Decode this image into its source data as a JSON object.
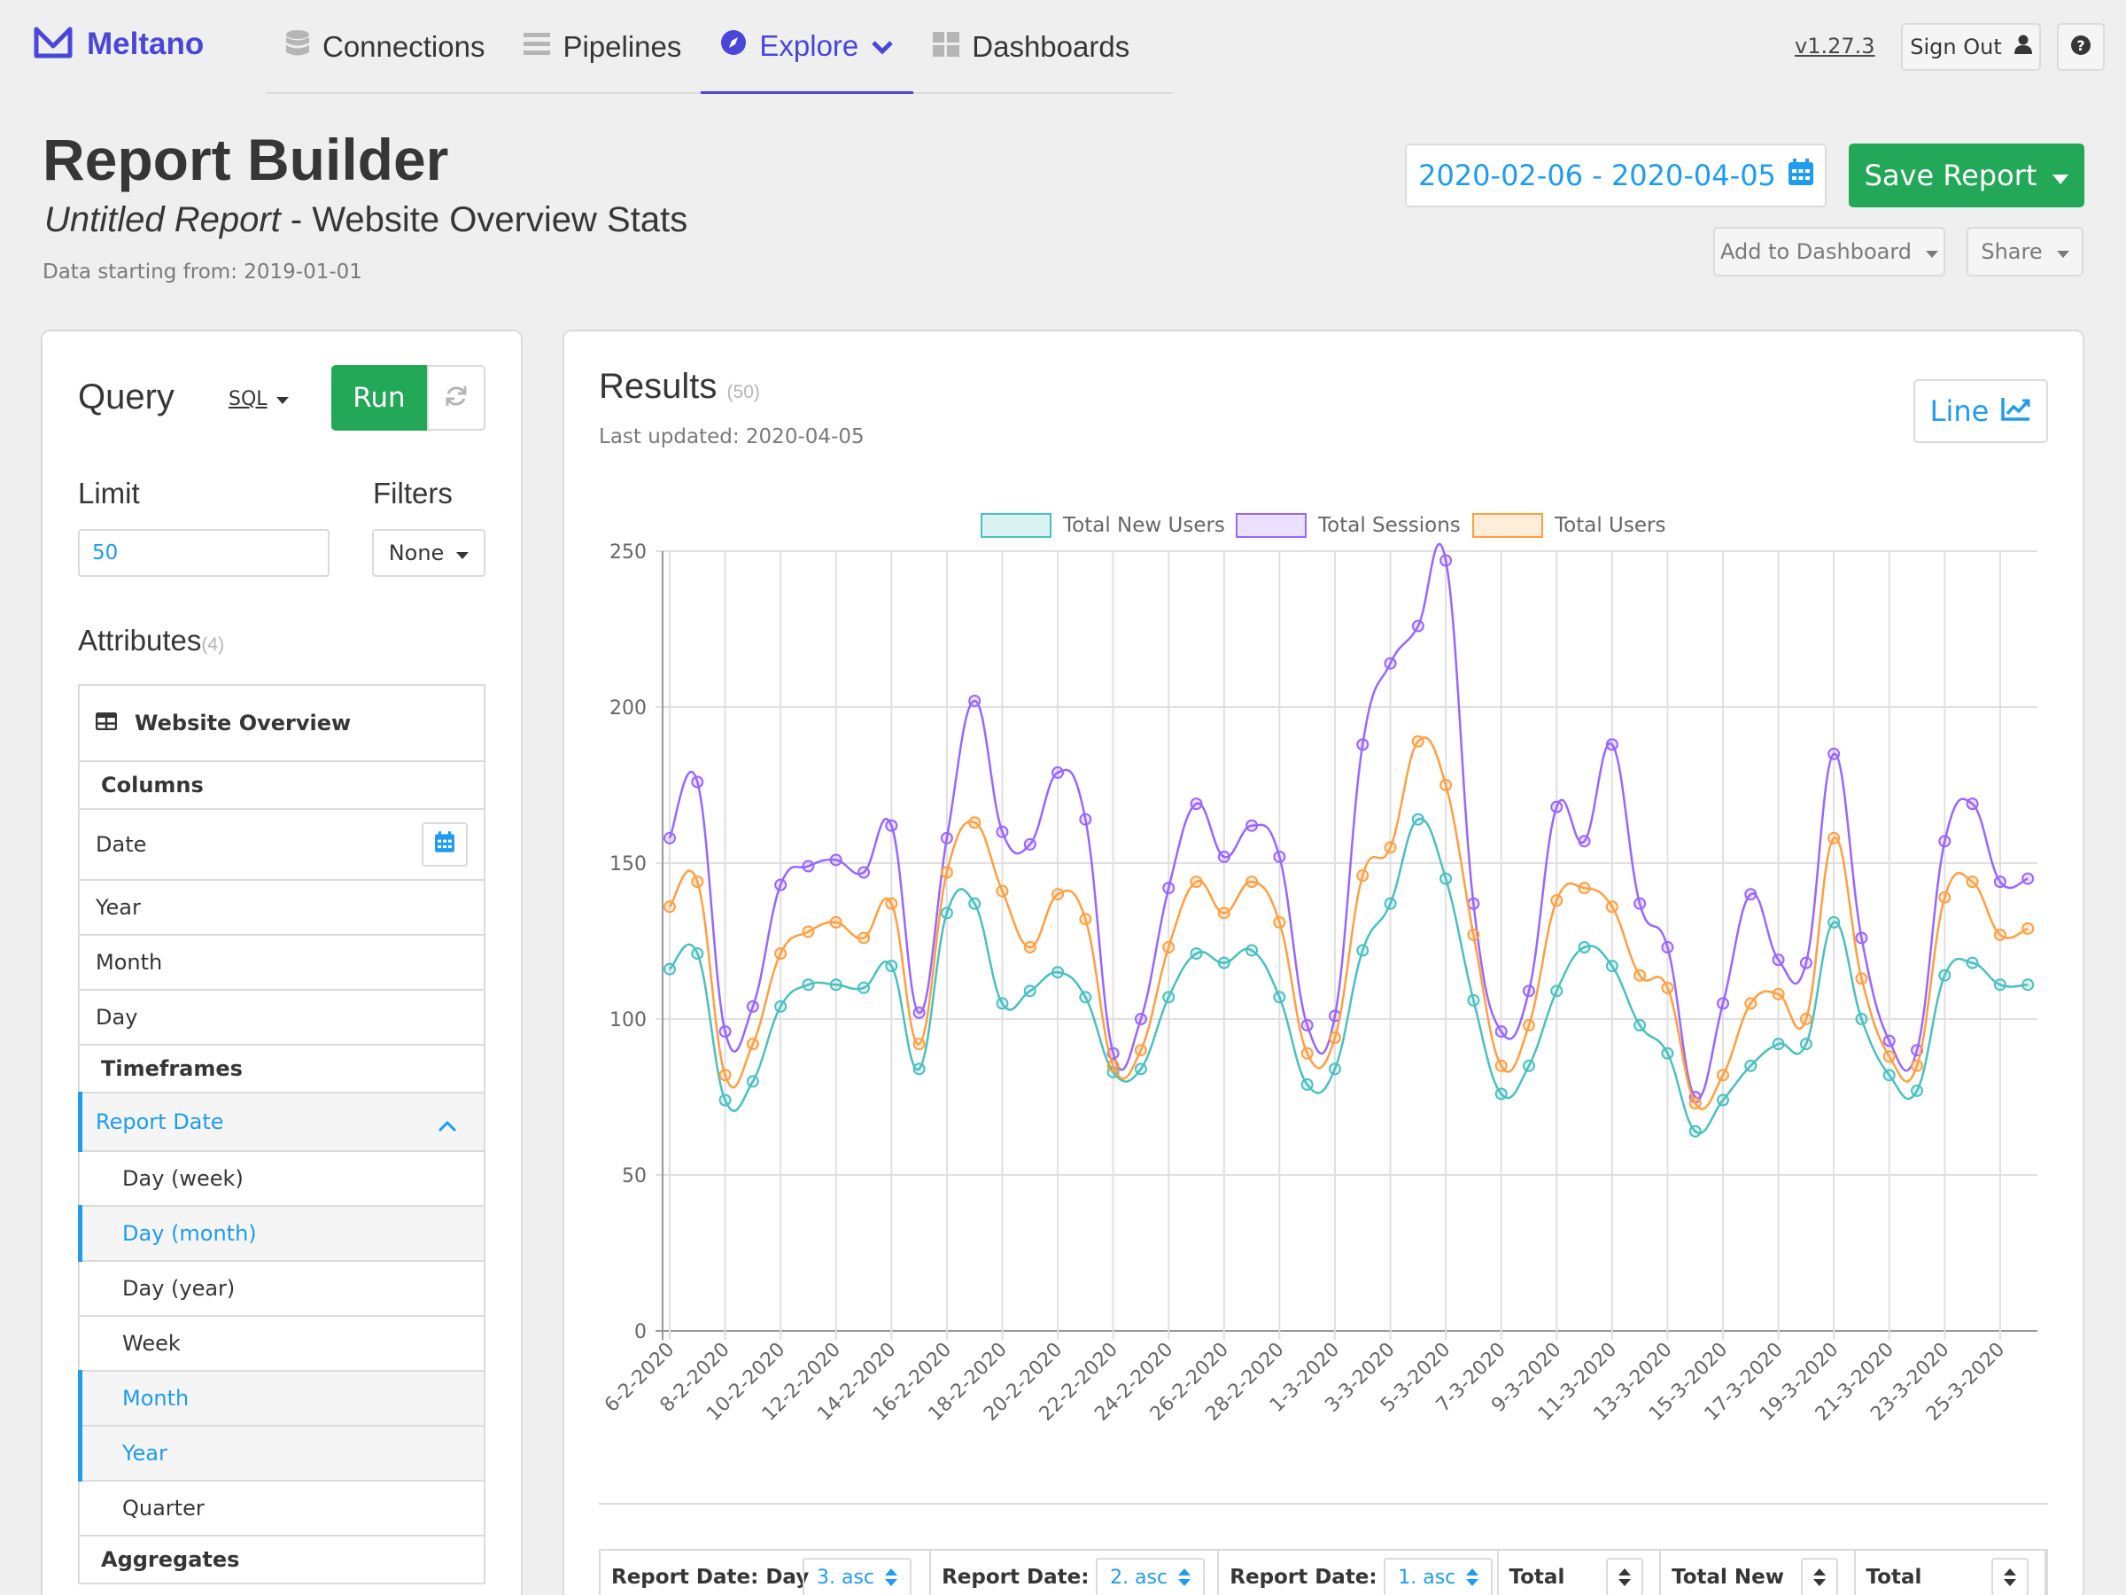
{
  "nav": {
    "brand": "Meltano",
    "tabs": [
      {
        "label": "Connections",
        "icon": "database-icon"
      },
      {
        "label": "Pipelines",
        "icon": "list-icon"
      },
      {
        "label": "Explore",
        "icon": "compass-icon",
        "active": true
      },
      {
        "label": "Dashboards",
        "icon": "grid-icon"
      }
    ],
    "version": "v1.27.3",
    "sign_out": "Sign Out"
  },
  "header": {
    "title": "Report Builder",
    "report_name": "Untitled Report",
    "subtitle_sep": " - ",
    "design": "Website Overview Stats",
    "data_starting": "Data starting from: 2019-01-01",
    "date_range": "2020-02-06 - 2020-04-05",
    "save_report": "Save Report",
    "add_to_dashboard": "Add to Dashboard",
    "share": "Share"
  },
  "query": {
    "title": "Query",
    "sql": "SQL",
    "run": "Run",
    "limit_label": "Limit",
    "limit_value": "50",
    "filters_label": "Filters",
    "filters_value": "None",
    "attributes_label": "Attributes",
    "attributes_count": "(4)",
    "table_name": "Website Overview",
    "columns_label": "Columns",
    "columns": [
      "Date",
      "Year",
      "Month",
      "Day"
    ],
    "timeframes_label": "Timeframes",
    "timeframe_group": "Report Date",
    "timeframes": [
      {
        "label": "Day (week)",
        "selected": false
      },
      {
        "label": "Day (month)",
        "selected": true
      },
      {
        "label": "Day (year)",
        "selected": false
      },
      {
        "label": "Week",
        "selected": false
      },
      {
        "label": "Month",
        "selected": true
      },
      {
        "label": "Year",
        "selected": true
      },
      {
        "label": "Quarter",
        "selected": false
      }
    ],
    "aggregates_label": "Aggregates"
  },
  "results": {
    "title": "Results",
    "count": "(50)",
    "last_updated": "Last updated: 2020-04-05",
    "chart_type_btn": "Line"
  },
  "colors": {
    "accent": "#4a46d8",
    "info": "#209cee",
    "success": "#23a858",
    "new_users": "#4bc0c0",
    "sessions": "#9966ff",
    "users": "#ff9f40"
  },
  "chart_data": {
    "type": "line",
    "categories": [
      "6-2-2020",
      "7-2-2020",
      "8-2-2020",
      "9-2-2020",
      "10-2-2020",
      "11-2-2020",
      "12-2-2020",
      "13-2-2020",
      "14-2-2020",
      "15-2-2020",
      "16-2-2020",
      "17-2-2020",
      "18-2-2020",
      "19-2-2020",
      "20-2-2020",
      "21-2-2020",
      "22-2-2020",
      "23-2-2020",
      "24-2-2020",
      "25-2-2020",
      "26-2-2020",
      "27-2-2020",
      "28-2-2020",
      "29-2-2020",
      "1-3-2020",
      "2-3-2020",
      "3-3-2020",
      "4-3-2020",
      "5-3-2020",
      "6-3-2020",
      "7-3-2020",
      "8-3-2020",
      "9-3-2020",
      "10-3-2020",
      "11-3-2020",
      "12-3-2020",
      "13-3-2020",
      "14-3-2020",
      "15-3-2020",
      "16-3-2020",
      "17-3-2020",
      "18-3-2020",
      "19-3-2020",
      "20-3-2020",
      "21-3-2020",
      "22-3-2020",
      "23-3-2020",
      "24-3-2020",
      "25-3-2020",
      "26-3-2020"
    ],
    "tick_labels": [
      "6-2-2020",
      "8-2-2020",
      "10-2-2020",
      "12-2-2020",
      "14-2-2020",
      "16-2-2020",
      "18-2-2020",
      "20-2-2020",
      "22-2-2020",
      "24-2-2020",
      "26-2-2020",
      "28-2-2020",
      "1-3-2020",
      "3-3-2020",
      "5-3-2020",
      "7-3-2020",
      "9-3-2020",
      "11-3-2020",
      "13-3-2020",
      "15-3-2020",
      "17-3-2020",
      "19-3-2020",
      "21-3-2020",
      "23-3-2020",
      "25-3-2020"
    ],
    "series": [
      {
        "name": "Total New Users",
        "color": "#4bc0c0",
        "fill": "rgba(75,192,192,0.2)",
        "values": [
          116,
          121,
          74,
          80,
          104,
          111,
          111,
          110,
          117,
          84,
          134,
          137,
          105,
          109,
          115,
          107,
          83,
          84,
          107,
          121,
          118,
          122,
          107,
          79,
          84,
          122,
          137,
          164,
          145,
          106,
          76,
          85,
          109,
          123,
          117,
          98,
          89,
          64,
          74,
          85,
          92,
          92,
          131,
          100,
          82,
          77,
          114,
          118,
          111,
          111
        ]
      },
      {
        "name": "Total Sessions",
        "color": "#9966ff",
        "fill": "rgba(153,102,255,0.2)",
        "values": [
          158,
          176,
          96,
          104,
          143,
          149,
          151,
          147,
          162,
          102,
          158,
          202,
          160,
          156,
          179,
          164,
          89,
          100,
          142,
          169,
          152,
          162,
          152,
          98,
          101,
          188,
          214,
          226,
          247,
          137,
          96,
          109,
          168,
          157,
          188,
          137,
          123,
          75,
          105,
          140,
          119,
          118,
          185,
          126,
          93,
          90,
          157,
          169,
          144,
          145
        ]
      },
      {
        "name": "Total Users",
        "color": "#ff9f40",
        "fill": "rgba(255,159,64,0.2)",
        "values": [
          136,
          144,
          82,
          92,
          121,
          128,
          131,
          126,
          137,
          92,
          147,
          163,
          141,
          123,
          140,
          132,
          85,
          90,
          123,
          144,
          134,
          144,
          131,
          89,
          94,
          146,
          155,
          189,
          175,
          127,
          85,
          98,
          138,
          142,
          136,
          114,
          110,
          73,
          82,
          105,
          108,
          100,
          158,
          113,
          88,
          85,
          139,
          144,
          127,
          129
        ]
      }
    ],
    "ylim": [
      0,
      250
    ],
    "yticks": [
      0,
      50,
      100,
      150,
      200,
      250
    ],
    "grid": true,
    "legend": "top-center"
  },
  "table": {
    "headers": [
      {
        "label": "Report Date: Day",
        "sort": "3. asc"
      },
      {
        "label": "Report Date:",
        "sort": "2. asc"
      },
      {
        "label": "Report Date:",
        "sort": "1. asc"
      },
      {
        "label": "Total",
        "sort": ""
      },
      {
        "label": "Total New",
        "sort": ""
      },
      {
        "label": "Total",
        "sort": ""
      }
    ]
  }
}
